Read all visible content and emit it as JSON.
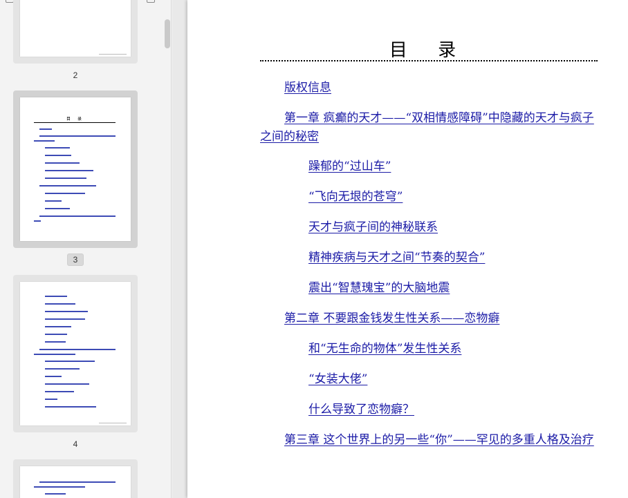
{
  "sidebar": {
    "thumbnails": [
      {
        "page_label": "2"
      },
      {
        "page_label": "3",
        "selected": true,
        "mini_title": "目  录"
      },
      {
        "page_label": "4"
      },
      {
        "page_label": ""
      }
    ]
  },
  "document": {
    "title": "目  录",
    "toc": [
      {
        "label": "版权信息",
        "level": 1
      },
      {
        "label": "第一章  疯癫的天才——“双相情感障碍”中隐藏的天才与疯子之间的秘密",
        "level": 1
      },
      {
        "label": "躁郁的“过山车”",
        "level": 2
      },
      {
        "label": "“飞向无垠的苍穹”",
        "level": 2
      },
      {
        "label": "天才与疯子间的神秘联系",
        "level": 2
      },
      {
        "label": "精神疾病与天才之间“节奏的契合”",
        "level": 2
      },
      {
        "label": "震出“智慧瑰宝”的大脑地震",
        "level": 2
      },
      {
        "label": "第二章 不要跟金钱发生性关系——恋物癖",
        "level": 1
      },
      {
        "label": "和“无生命的物体”发生性关系",
        "level": 2
      },
      {
        "label": "“女装大佬”",
        "level": 2
      },
      {
        "label": "什么导致了恋物癖？",
        "level": 2
      },
      {
        "label": "第三章  这个世界上的另一些“你”——罕见的多重人格及治疗",
        "level": 1
      }
    ]
  },
  "colors": {
    "link": "#1a1aa6",
    "sidebar_bg": "#f3f3f3",
    "viewer_bg": "#e9e9e9"
  }
}
